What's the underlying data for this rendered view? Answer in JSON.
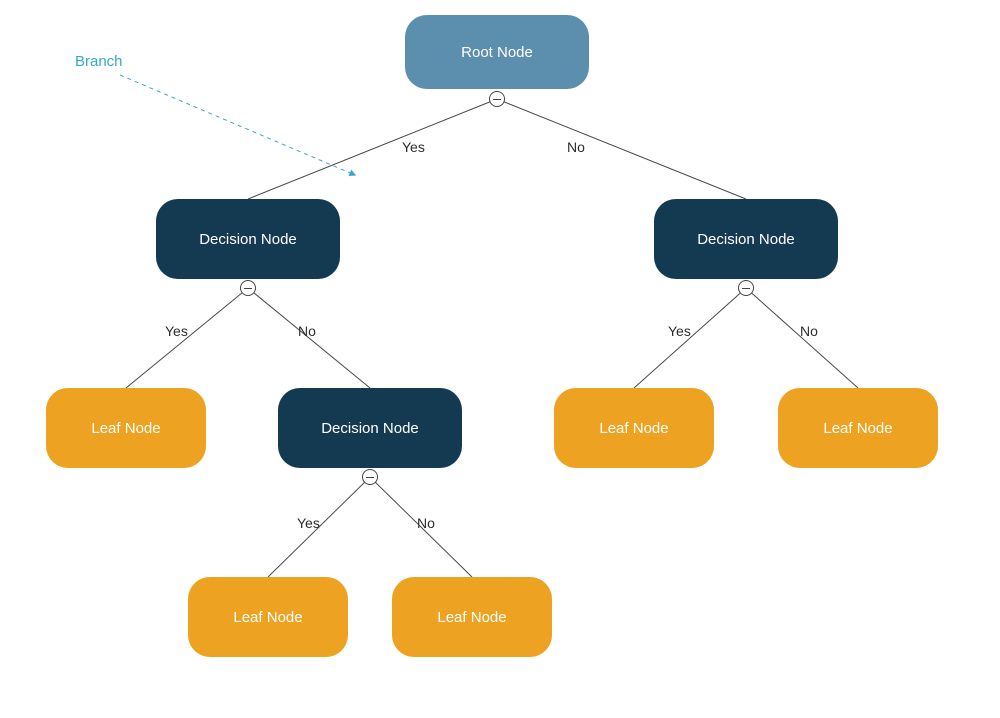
{
  "annotation": {
    "branch": "Branch"
  },
  "labels": {
    "yes": "Yes",
    "no": "No"
  },
  "nodes": {
    "root": {
      "text": "Root Node"
    },
    "dec1": {
      "text": "Decision Node"
    },
    "dec2": {
      "text": "Decision Node"
    },
    "dec3": {
      "text": "Decision Node"
    },
    "leaf1": {
      "text": "Leaf Node"
    },
    "leaf2": {
      "text": "Leaf Node"
    },
    "leaf3": {
      "text": "Leaf Node"
    },
    "leaf4": {
      "text": "Leaf Node"
    },
    "leaf5": {
      "text": "Leaf Node"
    }
  },
  "colors": {
    "root": "#5b8fad",
    "decision": "#143a52",
    "leaf": "#eea221",
    "annotation": "#3aa6c9",
    "edge": "#4a4a4a"
  }
}
